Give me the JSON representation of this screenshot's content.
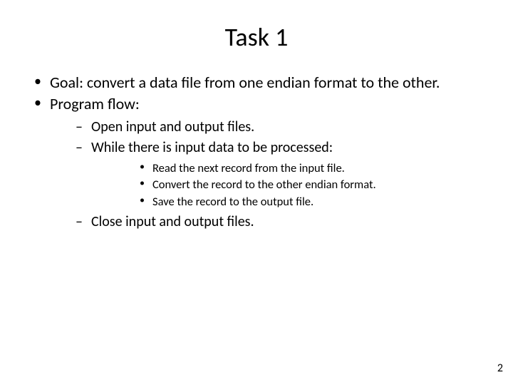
{
  "title": "Task 1",
  "bullets": {
    "lvl1": [
      "Goal: convert a data file from one endian format to the other.",
      "Program flow:"
    ],
    "lvl2_a": [
      "Open input and output files.",
      "While there is input data to be processed:"
    ],
    "lvl3": [
      "Read the next record from the input file.",
      "Convert the record to the other endian format.",
      "Save the record to the output file."
    ],
    "lvl2_b": [
      "Close input and output files."
    ]
  },
  "page_number": "2"
}
